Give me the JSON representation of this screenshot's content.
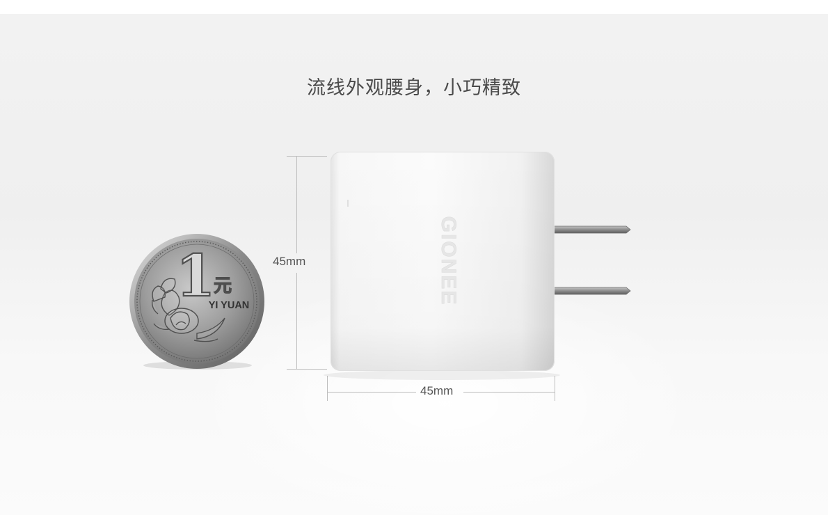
{
  "headline": "流线外观腰身，小巧精致",
  "coin": {
    "denomination_numeral": "1",
    "denomination_character": "元",
    "inscription": "YI YUAN"
  },
  "charger": {
    "brand": "GIONEE",
    "body_color": "#f4f4f4",
    "prong_color": "#9a9a9a"
  },
  "dimensions": {
    "height_label": "45mm",
    "width_label": "45mm"
  }
}
